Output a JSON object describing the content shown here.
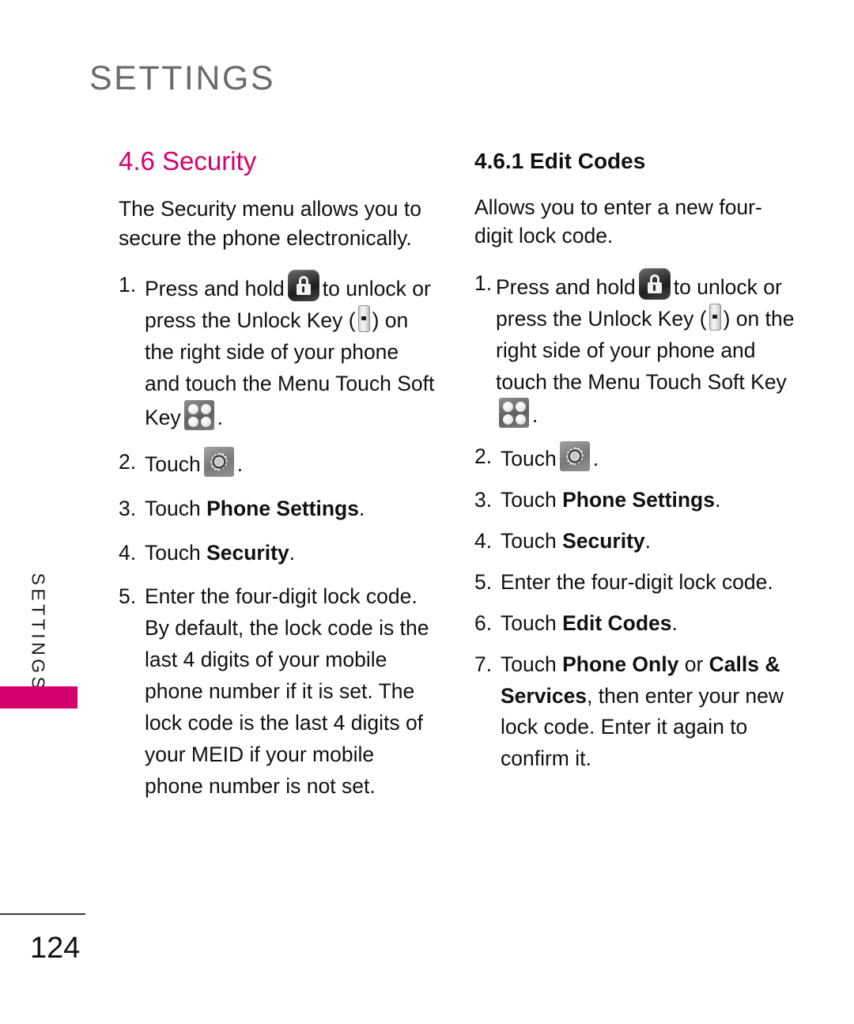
{
  "page": {
    "running_head": "SETTINGS",
    "side_tab_label": "SETTINGS",
    "folio": "124",
    "accent_color": "#d4006e",
    "running_head_color": "#6b6b6b",
    "text_color": "#111111"
  },
  "left_column": {
    "heading": "4.6 Security",
    "intro": "The Security menu allows you to secure the phone electronically.",
    "steps": [
      {
        "number": "1.",
        "text_part_1": "Press and hold",
        "icon_1": "lock-icon",
        "text_part_2": "to unlock or press the Unlock Key (",
        "icon_2": "unlock-key-icon",
        "text_part_3": ") on the right side of your phone and touch the Menu Touch Soft Key",
        "icon_3": "menu-soft-key-icon",
        "text_part_4": "."
      },
      {
        "number": "2.",
        "text_part_1": "Touch",
        "icon_1": "gear-icon",
        "text_part_2": "."
      },
      {
        "number": "3.",
        "text_part_1": "Touch",
        "bold_1": "Phone Settings",
        "text_part_2": "."
      },
      {
        "number": "4.",
        "text_part_1": "Touch",
        "bold_1": "Security",
        "text_part_2": "."
      },
      {
        "number": "5.",
        "text_part_1": "Enter the four-digit lock code. By default, the lock code is the last 4 digits of your mobile phone number if it is set. The lock code is the last 4 digits of your MEID if your mobile phone number is not set."
      }
    ]
  },
  "right_column": {
    "heading": "4.6.1 Edit Codes",
    "intro": "Allows you to enter a new four-digit lock code.",
    "steps": [
      {
        "number": "1.",
        "text_part_1": "Press and hold",
        "icon_1": "lock-icon",
        "text_part_2": "to unlock or press the Unlock Key (",
        "icon_2": "unlock-key-icon",
        "text_part_3": ") on the right side of your phone and touch the Menu Touch Soft Key",
        "icon_3": "menu-soft-key-icon",
        "text_part_4": "."
      },
      {
        "number": "2.",
        "text_part_1": "Touch",
        "icon_1": "gear-icon",
        "text_part_2": "."
      },
      {
        "number": "3.",
        "text_part_1": "Touch",
        "bold_1": "Phone Settings",
        "text_part_2": "."
      },
      {
        "number": "4.",
        "text_part_1": "Touch",
        "bold_1": "Security",
        "text_part_2": "."
      },
      {
        "number": "5.",
        "text_part_1": "Enter the four-digit lock code."
      },
      {
        "number": "6.",
        "text_part_1": "Touch",
        "bold_1": "Edit Codes",
        "text_part_2": "."
      },
      {
        "number": "7.",
        "text_part_1": "Touch",
        "bold_1": "Phone Only",
        "text_part_2": "or",
        "bold_2": "Calls & Services",
        "text_part_3": ", then enter your new lock code. Enter it again to confirm it."
      }
    ]
  }
}
